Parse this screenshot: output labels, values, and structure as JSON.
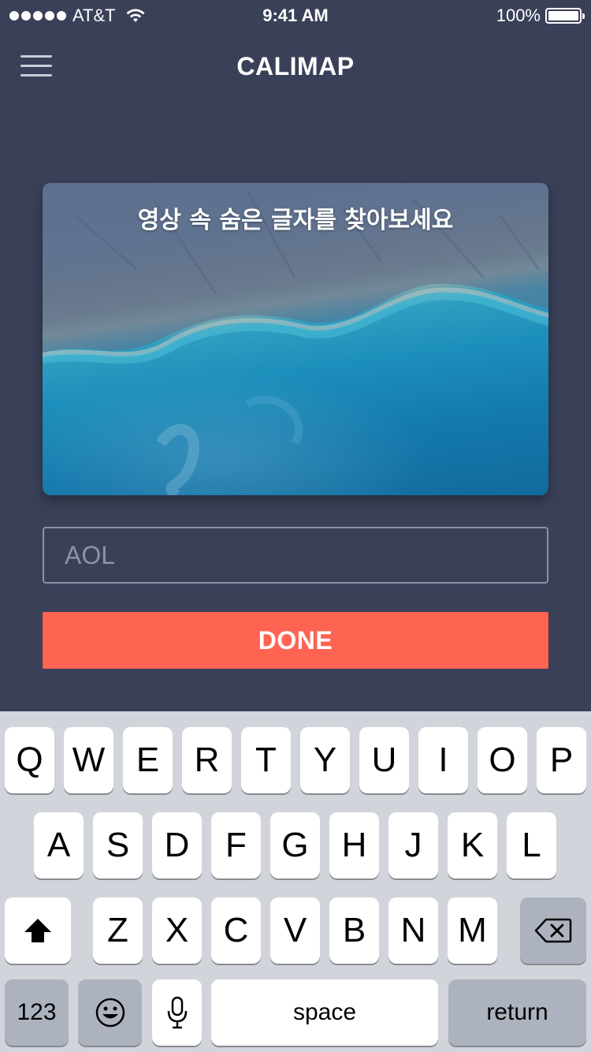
{
  "status_bar": {
    "carrier": "AT&T",
    "time": "9:41 AM",
    "battery": "100%"
  },
  "nav": {
    "title": "CALIMAP",
    "menu_icon": "hamburger-menu-icon"
  },
  "card": {
    "caption": "영상 속 숨은 글자를 찾아보세요"
  },
  "answer": {
    "placeholder": "AOL"
  },
  "done_label": "DONE",
  "keyboard": {
    "row1": [
      "Q",
      "W",
      "E",
      "R",
      "T",
      "Y",
      "U",
      "I",
      "O",
      "P"
    ],
    "row2": [
      "A",
      "S",
      "D",
      "F",
      "G",
      "H",
      "J",
      "K",
      "L"
    ],
    "row3": [
      "Z",
      "X",
      "C",
      "V",
      "B",
      "N",
      "M"
    ],
    "numbers_label": "123",
    "space_label": "space",
    "return_label": "return",
    "shift_icon": "shift-arrow-icon",
    "delete_icon": "backspace-icon",
    "emoji_icon": "emoji-icon",
    "mic_icon": "microphone-icon"
  }
}
